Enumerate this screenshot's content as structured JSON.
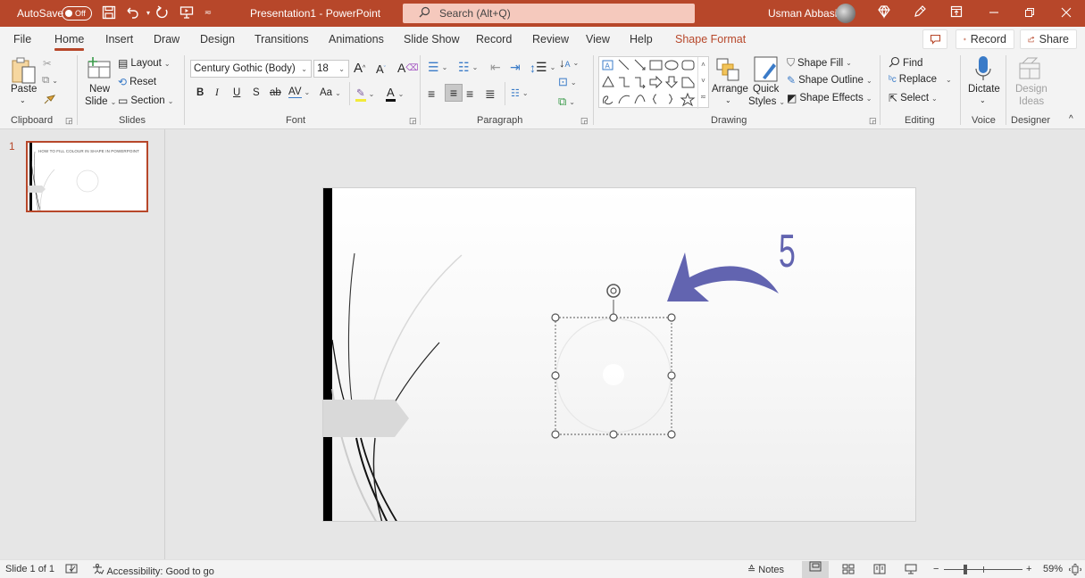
{
  "titlebar": {
    "autosave_label": "AutoSave",
    "autosave_state": "Off",
    "document_title": "Presentation1  -  PowerPoint",
    "search_placeholder": "Search (Alt+Q)",
    "user_name": "Usman Abbasi",
    "accent_color": "#b7472a"
  },
  "tabs": {
    "items": [
      {
        "label": "File"
      },
      {
        "label": "Home"
      },
      {
        "label": "Insert"
      },
      {
        "label": "Draw"
      },
      {
        "label": "Design"
      },
      {
        "label": "Transitions"
      },
      {
        "label": "Animations"
      },
      {
        "label": "Slide Show"
      },
      {
        "label": "Record"
      },
      {
        "label": "Review"
      },
      {
        "label": "View"
      },
      {
        "label": "Help"
      },
      {
        "label": "Shape Format"
      }
    ],
    "active": "Home",
    "record_button": "Record",
    "share_button": "Share"
  },
  "ribbon": {
    "clipboard": {
      "label": "Clipboard",
      "paste": "Paste"
    },
    "slides": {
      "label": "Slides",
      "new_slide_line1": "New",
      "new_slide_line2": "Slide",
      "layout": "Layout",
      "reset": "Reset",
      "section": "Section"
    },
    "font": {
      "label": "Font",
      "font_name": "Century Gothic (Body)",
      "font_size": "18",
      "bold": "B",
      "italic": "I",
      "underline": "U",
      "shadow": "S",
      "strike": "ab",
      "spacing": "AV",
      "case": "Aa",
      "grow": "A",
      "shrink": "A",
      "color_letter": "A"
    },
    "paragraph": {
      "label": "Paragraph"
    },
    "drawing": {
      "label": "Drawing",
      "arrange": "Arrange",
      "quick_styles_line1": "Quick",
      "quick_styles_line2": "Styles",
      "shape_fill": "Shape Fill",
      "shape_outline": "Shape Outline",
      "shape_effects": "Shape Effects"
    },
    "editing": {
      "label": "Editing",
      "find": "Find",
      "replace": "Replace",
      "select": "Select"
    },
    "voice": {
      "label": "Voice",
      "dictate": "Dictate"
    },
    "designer": {
      "label": "Designer",
      "design_ideas_line1": "Design",
      "design_ideas_line2": "Ideas"
    }
  },
  "thumbnails": {
    "items": [
      {
        "number": "1",
        "title": "HOW TO FILL COLOUR IN SHAPE IN POWERPOINT"
      }
    ]
  },
  "slide": {
    "annotation_number": "5",
    "arrow_color": "#6264b0"
  },
  "statusbar": {
    "slide_info": "Slide 1 of 1",
    "accessibility": "Accessibility: Good to go",
    "notes": "Notes",
    "zoom_level": "59%",
    "zoom_fraction": 0.59
  }
}
